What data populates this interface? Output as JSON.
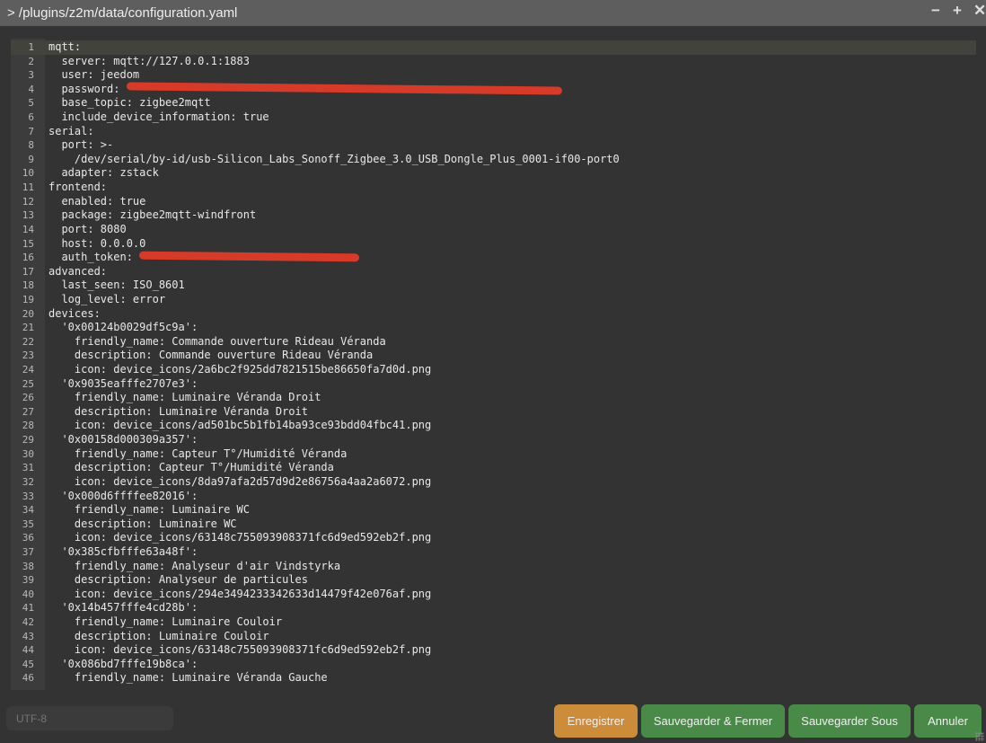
{
  "window": {
    "title": "> /plugins/z2m/data/configuration.yaml",
    "controls": {
      "minimize": "−",
      "maximize": "+",
      "close": "✕"
    }
  },
  "editor": {
    "active_line": 1,
    "redaction_color": "#d63a28",
    "lines": [
      {
        "text": "mqtt:"
      },
      {
        "text": "  server: mqtt://127.0.0.1:1883"
      },
      {
        "text": "  user: jeedom"
      },
      {
        "text": "  password: ",
        "redacted": true
      },
      {
        "text": "  base_topic: zigbee2mqtt"
      },
      {
        "text": "  include_device_information: true"
      },
      {
        "text": "serial:"
      },
      {
        "text": "  port: >-"
      },
      {
        "text": "    /dev/serial/by-id/usb-Silicon_Labs_Sonoff_Zigbee_3.0_USB_Dongle_Plus_0001-if00-port0"
      },
      {
        "text": "  adapter: zstack"
      },
      {
        "text": "frontend:"
      },
      {
        "text": "  enabled: true"
      },
      {
        "text": "  package: zigbee2mqtt-windfront"
      },
      {
        "text": "  port: 8080"
      },
      {
        "text": "  host: 0.0.0.0"
      },
      {
        "text": "  auth_token: ",
        "redacted": true
      },
      {
        "text": "advanced:"
      },
      {
        "text": "  last_seen: ISO_8601"
      },
      {
        "text": "  log_level: error"
      },
      {
        "text": "devices:"
      },
      {
        "text": "  '0x00124b0029df5c9a':"
      },
      {
        "text": "    friendly_name: Commande ouverture Rideau Véranda"
      },
      {
        "text": "    description: Commande ouverture Rideau Véranda"
      },
      {
        "text": "    icon: device_icons/2a6bc2f925dd7821515be86650fa7d0d.png"
      },
      {
        "text": "  '0x9035eafffe2707e3':"
      },
      {
        "text": "    friendly_name: Luminaire Véranda Droit"
      },
      {
        "text": "    description: Luminaire Véranda Droit"
      },
      {
        "text": "    icon: device_icons/ad501bc5b1fb14ba93ce93bdd04fbc41.png"
      },
      {
        "text": "  '0x00158d000309a357':"
      },
      {
        "text": "    friendly_name: Capteur T°/Humidité Véranda"
      },
      {
        "text": "    description: Capteur T°/Humidité Véranda"
      },
      {
        "text": "    icon: device_icons/8da97afa2d57d9d2e86756a4aa2a6072.png"
      },
      {
        "text": "  '0x000d6ffffee82016':"
      },
      {
        "text": "    friendly_name: Luminaire WC"
      },
      {
        "text": "    description: Luminaire WC"
      },
      {
        "text": "    icon: device_icons/63148c755093908371fc6d9ed592eb2f.png"
      },
      {
        "text": "  '0x385cfbfffe63a48f':"
      },
      {
        "text": "    friendly_name: Analyseur d'air Vindstyrka"
      },
      {
        "text": "    description: Analyseur de particules"
      },
      {
        "text": "    icon: device_icons/294e3494233342633d14479f42e076af.png"
      },
      {
        "text": "  '0x14b457fffe4cd28b':"
      },
      {
        "text": "    friendly_name: Luminaire Couloir"
      },
      {
        "text": "    description: Luminaire Couloir"
      },
      {
        "text": "    icon: device_icons/63148c755093908371fc6d9ed592eb2f.png"
      },
      {
        "text": "  '0x086bd7fffe19b8ca':"
      },
      {
        "text": "    friendly_name: Luminaire Véranda Gauche"
      }
    ]
  },
  "footer": {
    "encoding_placeholder": "UTF-8",
    "buttons": [
      {
        "label": "Enregistrer",
        "color": "#cc8c3a"
      },
      {
        "label": "Sauvegarder & Fermer",
        "color": "#4a8a48"
      },
      {
        "label": "Sauvegarder Sous",
        "color": "#4a8a48"
      },
      {
        "label": "Annuler",
        "color": "#4a8a48"
      }
    ]
  }
}
